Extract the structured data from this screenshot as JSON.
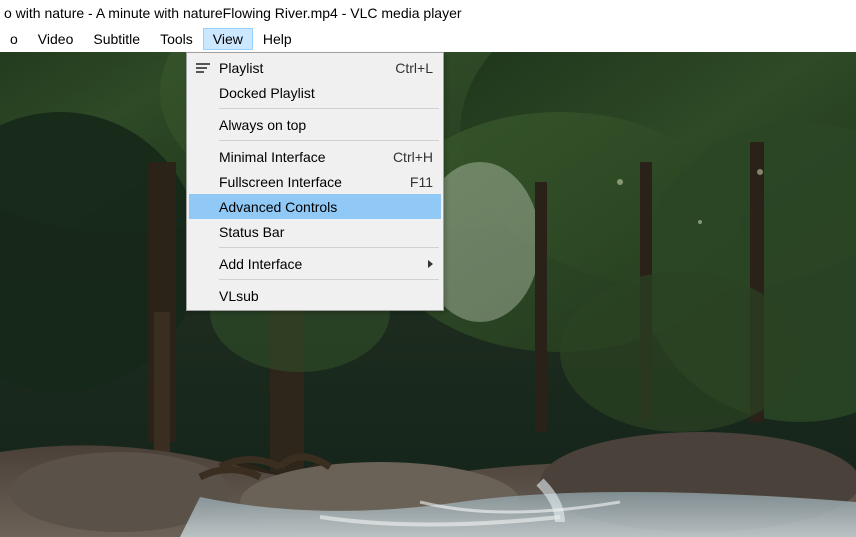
{
  "title_bar": {
    "text": "o with nature - A minute with natureFlowing River.mp4 - VLC media player"
  },
  "menu_bar": {
    "items": [
      {
        "label": "o",
        "active": false
      },
      {
        "label": "Video",
        "active": false
      },
      {
        "label": "Subtitle",
        "active": false
      },
      {
        "label": "Tools",
        "active": false
      },
      {
        "label": "View",
        "active": true
      },
      {
        "label": "Help",
        "active": false
      }
    ]
  },
  "dropdown": {
    "items": [
      {
        "label": "Playlist",
        "shortcut": "Ctrl+L",
        "icon": "playlist",
        "highlight": false,
        "submenu": false
      },
      {
        "label": "Docked Playlist",
        "shortcut": "",
        "icon": "",
        "highlight": false,
        "submenu": false
      },
      {
        "sep": true
      },
      {
        "label": "Always on top",
        "shortcut": "",
        "icon": "",
        "highlight": false,
        "submenu": false
      },
      {
        "sep": true
      },
      {
        "label": "Minimal Interface",
        "shortcut": "Ctrl+H",
        "icon": "",
        "highlight": false,
        "submenu": false
      },
      {
        "label": "Fullscreen Interface",
        "shortcut": "F11",
        "icon": "",
        "highlight": false,
        "submenu": false
      },
      {
        "label": "Advanced Controls",
        "shortcut": "",
        "icon": "",
        "highlight": true,
        "submenu": false
      },
      {
        "label": "Status Bar",
        "shortcut": "",
        "icon": "",
        "highlight": false,
        "submenu": false
      },
      {
        "sep": true
      },
      {
        "label": "Add Interface",
        "shortcut": "",
        "icon": "",
        "highlight": false,
        "submenu": true
      },
      {
        "sep": true
      },
      {
        "label": "VLsub",
        "shortcut": "",
        "icon": "",
        "highlight": false,
        "submenu": false
      }
    ]
  }
}
